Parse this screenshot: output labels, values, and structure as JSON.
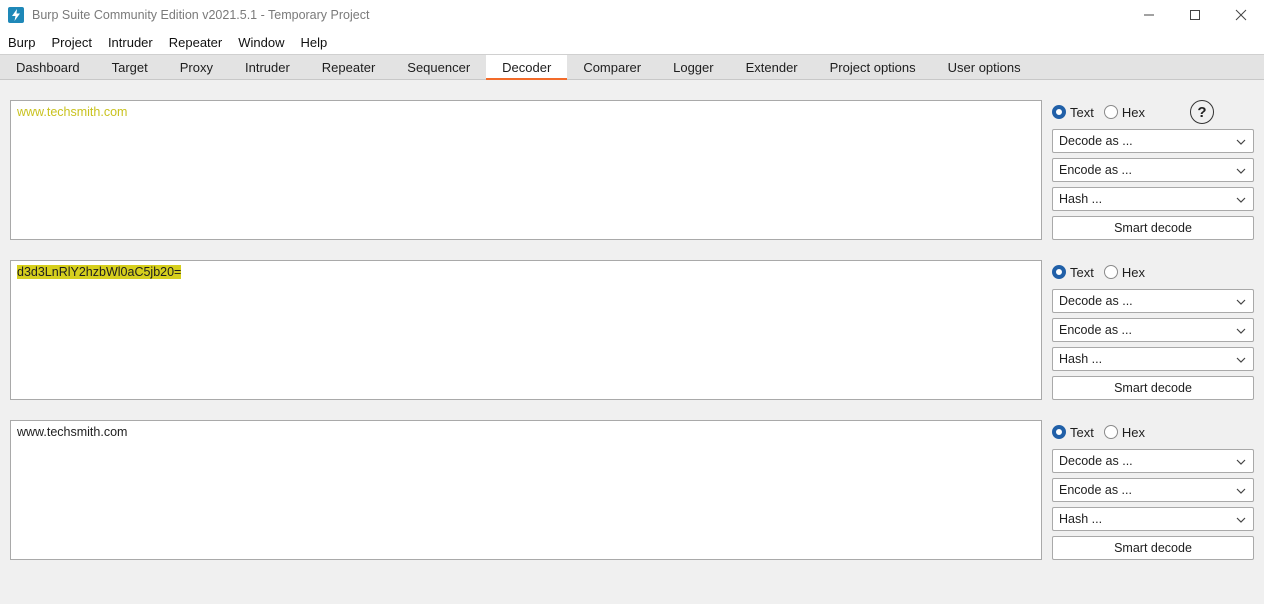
{
  "window": {
    "title": "Burp Suite Community Edition v2021.5.1 - Temporary Project"
  },
  "menu": [
    "Burp",
    "Project",
    "Intruder",
    "Repeater",
    "Window",
    "Help"
  ],
  "tabs": [
    {
      "label": "Dashboard",
      "active": false
    },
    {
      "label": "Target",
      "active": false
    },
    {
      "label": "Proxy",
      "active": false
    },
    {
      "label": "Intruder",
      "active": false
    },
    {
      "label": "Repeater",
      "active": false
    },
    {
      "label": "Sequencer",
      "active": false
    },
    {
      "label": "Decoder",
      "active": true
    },
    {
      "label": "Comparer",
      "active": false
    },
    {
      "label": "Logger",
      "active": false
    },
    {
      "label": "Extender",
      "active": false
    },
    {
      "label": "Project options",
      "active": false
    },
    {
      "label": "User options",
      "active": false
    }
  ],
  "panels": [
    {
      "content": "www.techsmith.com",
      "radio_text": "Text",
      "radio_hex": "Hex",
      "selected": "Text",
      "decode_label": "Decode as ...",
      "encode_label": "Encode as ...",
      "hash_label": "Hash ...",
      "smart_label": "Smart decode"
    },
    {
      "content": "d3d3LnRlY2hzbWl0aC5jb20=",
      "radio_text": "Text",
      "radio_hex": "Hex",
      "selected": "Text",
      "decode_label": "Decode as ...",
      "encode_label": "Encode as ...",
      "hash_label": "Hash ...",
      "smart_label": "Smart decode"
    },
    {
      "content": "www.techsmith.com",
      "radio_text": "Text",
      "radio_hex": "Hex",
      "selected": "Text",
      "decode_label": "Decode as ...",
      "encode_label": "Encode as ...",
      "hash_label": "Hash ...",
      "smart_label": "Smart decode"
    }
  ],
  "help": {
    "glyph": "?"
  },
  "colors": {
    "accent_tab": "#f26b2a",
    "radio_checked": "#2160a8",
    "highlight": "#d6cf1d",
    "app_icon": "#1e88b8"
  },
  "icons": {
    "app": "burp-lightning-icon",
    "minimize": "minimize-icon",
    "maximize": "maximize-icon",
    "close": "close-icon",
    "help": "help-icon",
    "dropdown": "chevron-down-icon"
  }
}
